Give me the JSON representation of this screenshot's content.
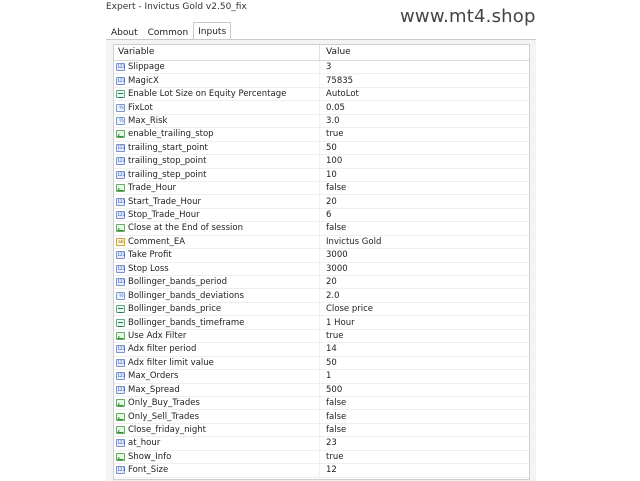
{
  "window": {
    "title": "Expert - Invictus Gold v2.50_fix"
  },
  "watermark": "www.mt4.shop",
  "tabs": [
    {
      "label": "About",
      "active": false
    },
    {
      "label": "Common",
      "active": false
    },
    {
      "label": "Inputs",
      "active": true
    }
  ],
  "grid": {
    "col_variable": "Variable",
    "col_value": "Value",
    "rows": [
      {
        "variable": "Slippage",
        "value": "3",
        "icon": "number-icon"
      },
      {
        "variable": "MagicX",
        "value": "75835",
        "icon": "number-icon"
      },
      {
        "variable": "Enable Lot Size on Equity Percentage",
        "value": "AutoLot",
        "icon": "enum-icon"
      },
      {
        "variable": "FixLot",
        "value": "0.05",
        "icon": "double-icon"
      },
      {
        "variable": "Max_Risk",
        "value": "3.0",
        "icon": "double-icon"
      },
      {
        "variable": "enable_trailing_stop",
        "value": "true",
        "icon": "bool-icon"
      },
      {
        "variable": "trailing_start_point",
        "value": "50",
        "icon": "number-icon"
      },
      {
        "variable": "trailing_stop_point",
        "value": "100",
        "icon": "number-icon"
      },
      {
        "variable": "trailing_step_point",
        "value": "10",
        "icon": "number-icon"
      },
      {
        "variable": "Trade_Hour",
        "value": "false",
        "icon": "bool-icon"
      },
      {
        "variable": "Start_Trade_Hour",
        "value": "20",
        "icon": "number-icon"
      },
      {
        "variable": "Stop_Trade_Hour",
        "value": "6",
        "icon": "number-icon"
      },
      {
        "variable": "Close at the End of session",
        "value": "false",
        "icon": "bool-icon"
      },
      {
        "variable": "Comment_EA",
        "value": "Invictus Gold",
        "icon": "string-icon"
      },
      {
        "variable": "Take Profit",
        "value": "3000",
        "icon": "number-icon"
      },
      {
        "variable": "Stop Loss",
        "value": "3000",
        "icon": "number-icon"
      },
      {
        "variable": "Bollinger_bands_period",
        "value": "20",
        "icon": "number-icon"
      },
      {
        "variable": "Bollinger_bands_deviations",
        "value": "2.0",
        "icon": "double-icon"
      },
      {
        "variable": "Bollinger_bands_price",
        "value": "Close price",
        "icon": "enum-icon"
      },
      {
        "variable": "Bollinger_bands_timeframe",
        "value": "1 Hour",
        "icon": "enum-icon"
      },
      {
        "variable": "Use Adx Filter",
        "value": "true",
        "icon": "bool-icon"
      },
      {
        "variable": "Adx filter period",
        "value": "14",
        "icon": "number-icon"
      },
      {
        "variable": "Adx filter limit value",
        "value": "50",
        "icon": "number-icon"
      },
      {
        "variable": "Max_Orders",
        "value": "1",
        "icon": "number-icon"
      },
      {
        "variable": "Max_Spread",
        "value": "500",
        "icon": "number-icon"
      },
      {
        "variable": "Only_Buy_Trades",
        "value": "false",
        "icon": "bool-icon"
      },
      {
        "variable": "Only_Sell_Trades",
        "value": "false",
        "icon": "bool-icon"
      },
      {
        "variable": "Close_friday_night",
        "value": "false",
        "icon": "bool-icon"
      },
      {
        "variable": "at_hour",
        "value": "23",
        "icon": "number-icon"
      },
      {
        "variable": "Show_Info",
        "value": "true",
        "icon": "bool-icon"
      },
      {
        "variable": "Font_Size",
        "value": "12",
        "icon": "number-icon"
      }
    ]
  }
}
